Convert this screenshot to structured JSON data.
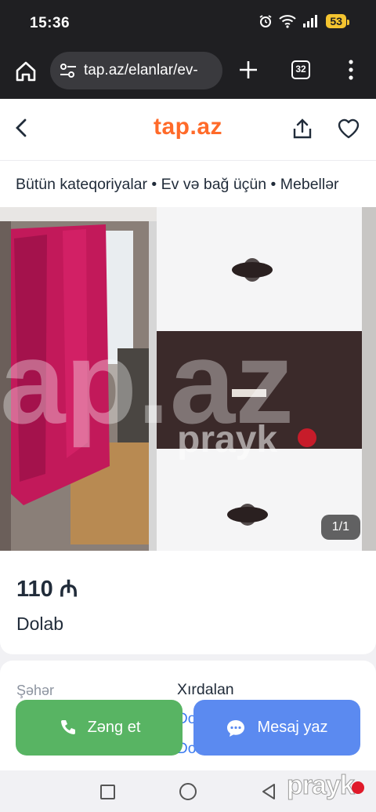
{
  "status": {
    "time": "15:36",
    "battery": "53"
  },
  "browser": {
    "url": "tap.az/elanlar/ev-",
    "tab_count": "32"
  },
  "header": {
    "logo": "tap.az"
  },
  "breadcrumb": "Bütün kateqoriyalar • Ev və bağ üçün • Mebellər",
  "photo": {
    "counter": "1/1",
    "watermark_main": "ap.az",
    "watermark_brand": "prayk"
  },
  "listing": {
    "price": "110 ₼",
    "title": "Dolab"
  },
  "details": {
    "city_label": "Şəhər",
    "city_value": "Xırdalan",
    "row2_value": "Do",
    "row3_value": "Do"
  },
  "actions": {
    "call_label": "Zəng et",
    "message_label": "Mesaj yaz"
  },
  "nav_watermark": "prayk",
  "colors": {
    "brand": "#ff6a29",
    "call_button": "#58b463",
    "message_button": "#5b8af0",
    "link": "#3a7af0"
  }
}
